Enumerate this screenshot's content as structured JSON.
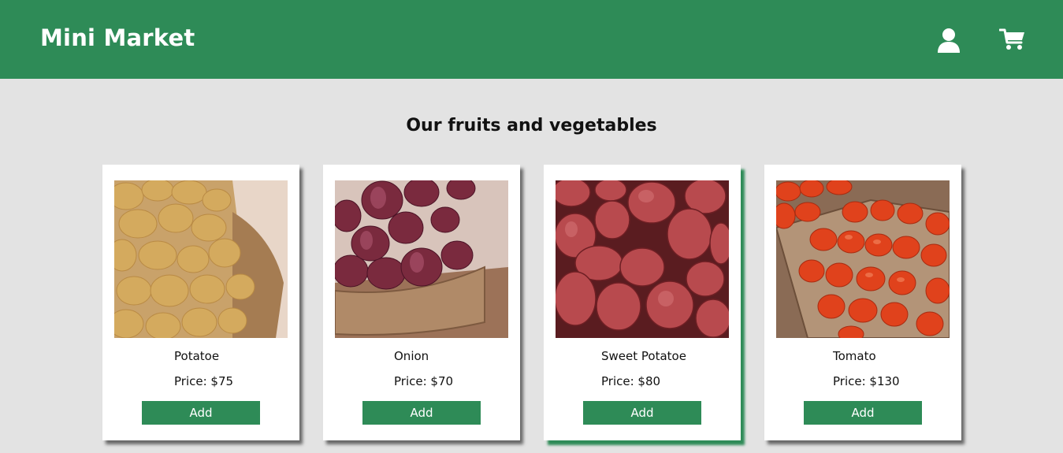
{
  "header": {
    "brand": "Mini Market",
    "icons": [
      "user-icon",
      "cart-icon"
    ]
  },
  "main": {
    "title": "Our fruits and vegetables",
    "products": [
      {
        "name": "Potatoe",
        "price": "Price: $75",
        "button": "Add"
      },
      {
        "name": "Onion",
        "price": "Price: $70",
        "button": "Add"
      },
      {
        "name": "Sweet Potatoe",
        "price": "Price: $80",
        "button": "Add"
      },
      {
        "name": "Tomato",
        "price": "Price: $130",
        "button": "Add"
      }
    ]
  },
  "colors": {
    "brand_green": "#2e8b57",
    "page_background": "#e3e3e3",
    "card_background": "#ffffff"
  }
}
